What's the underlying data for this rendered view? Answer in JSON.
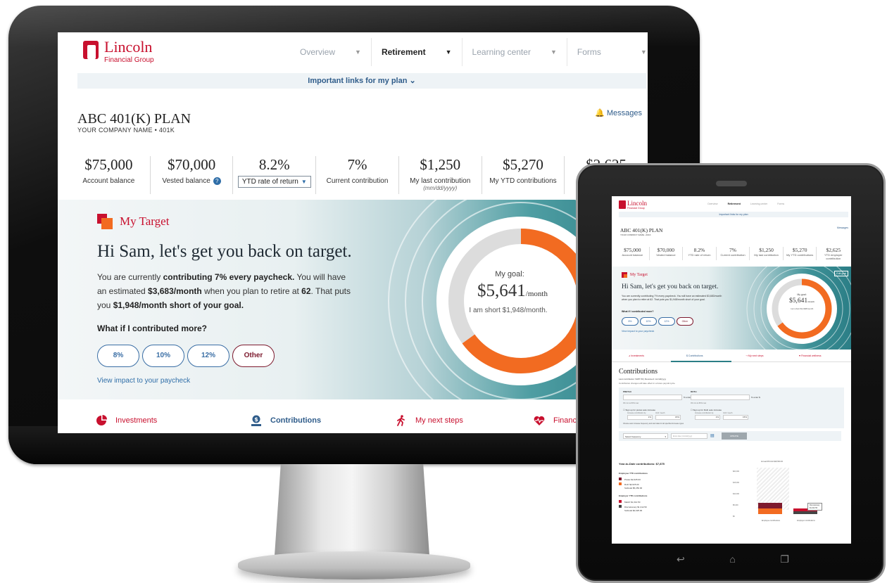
{
  "brand": {
    "name": "Lincoln",
    "sub": "Financial Group",
    "color": "#c8102e",
    "accent": "#f26b21",
    "link": "#2f5c8a"
  },
  "nav": {
    "items": [
      {
        "label": "Overview"
      },
      {
        "label": "Retirement"
      },
      {
        "label": "Learning center"
      },
      {
        "label": "Forms"
      }
    ]
  },
  "links_bar": "Important links for my plan",
  "plan": {
    "title": "ABC 401(K) PLAN",
    "subtitle": "YOUR COMPANY NAME • 401K"
  },
  "messages": "Messages",
  "stats": [
    {
      "value": "$75,000",
      "label": "Account balance"
    },
    {
      "value": "$70,000",
      "label": "Vested balance"
    },
    {
      "value": "8.2%",
      "label": "YTD rate of return"
    },
    {
      "value": "7%",
      "label": "Current contribution"
    },
    {
      "value": "$1,250",
      "label": "My last contribution",
      "sub": "(mm/dd/yyyy)"
    },
    {
      "value": "$5,270",
      "label": "My YTD contributions"
    },
    {
      "value": "$2,625",
      "label": ""
    }
  ],
  "target": {
    "title": "My Target",
    "headline": "Hi Sam, let's get you back on target.",
    "desc_1": "You are currently ",
    "desc_b1": "contributing 7% every paycheck.",
    "desc_2": " You will have an estimated ",
    "desc_b2": "$3,683/month",
    "desc_3": " when you plan to retire at ",
    "desc_b3": "62",
    "desc_4": ". That puts you ",
    "desc_b4": "$1,948/month short of your goal.",
    "whatif": "What if I contributed more?",
    "options": [
      "8%",
      "10%",
      "12%",
      "Other"
    ],
    "view_impact": "View impact to your paycheck",
    "goal_label": "My goal:",
    "goal_value": "$5,641",
    "goal_unit": "/month",
    "goal_short": "I am short $1,948/month.",
    "progress_fraction": 0.65
  },
  "tabs": [
    {
      "label": "Investments"
    },
    {
      "label": "Contributions"
    },
    {
      "label": "My next steps"
    },
    {
      "label": "Financi"
    }
  ],
  "tablet": {
    "brand": "Lincoln",
    "brand_sub": "Financial Group",
    "nav": [
      "Overview",
      "Retirement",
      "Learning center",
      "Forms"
    ],
    "links_bar": "Important links for my plan",
    "plan_title": "ABC 401(K) PLAN",
    "plan_sub": "YOUR COMPANY NAME • 401K",
    "messages": "Messages",
    "stats": [
      {
        "value": "$75,000",
        "label": "Account balance"
      },
      {
        "value": "$70,000",
        "label": "Vested balance"
      },
      {
        "value": "8.2%",
        "label": "YTD rate of return"
      },
      {
        "value": "7%",
        "label": "Current contribution"
      },
      {
        "value": "$1,250",
        "label": "My last contribution"
      },
      {
        "value": "$5,270",
        "label": "My YTD contributions"
      },
      {
        "value": "$2,625",
        "label": "YTD employer contribution"
      }
    ],
    "target_title": "My Target",
    "edit_goal": "Edit goal",
    "headline": "Hi Sam, let's get you back on target.",
    "desc": "You are currently contributing 7% every paycheck. You will have an estimated $3,683/month when you plan to retire at 62. That puts you $1,948/month short of your goal.",
    "whatif": "What if I contributed more?",
    "options": [
      "8%",
      "10%",
      "12%",
      "Other"
    ],
    "view_impact": "View impact to your paycheck",
    "goal_label": "My goal:",
    "goal_value": "$5,641",
    "goal_unit": "/month",
    "goal_short": "I am short $1,948/month",
    "tabs": [
      "Investments",
      "Contributions",
      "My next steps",
      "Financial wellness"
    ],
    "contributions": {
      "title": "Contributions",
      "last": "Last contribution: $187.50",
      "received": "Received: mm/dd/yyyy",
      "note": "Contribution changes will take effect in a future payroll cycle.",
      "pretax_label": "PRETAX",
      "roth_label": "ROTH",
      "pretax_suffix": "% enter $",
      "roth_suffix": "% enter $",
      "pretax_hint": "0% min to 80% max",
      "roth_hint": "0% min to 80% max",
      "pretax_auto": "Sign up for pretax auto increase",
      "roth_auto": "Sign up for Roth auto increase",
      "pretax_inc_label": "Increase contribution by",
      "pretax_until_label": "Until I reach",
      "pretax_inc": "1%",
      "pretax_until": "15%",
      "roth_inc_label": "Increase contribution by",
      "roth_until_label": "Until I reach",
      "roth_inc": "1%",
      "roth_until": "15%",
      "frequency_note": "Choose auto increase frequency and start date for all specified increase types",
      "frequency_placeholder": "Select frequency",
      "date_placeholder": "Enter date (mm/dd/yyyy)",
      "update": "UPDATE",
      "ytd_title": "Year-to-Date contributions: $7,875",
      "employee_title": "Employee YTD contributions",
      "employee_rows": [
        {
          "name": "Pretax",
          "value": "$2,625.00"
        },
        {
          "name": "Roth",
          "value": "$2,625.00"
        },
        {
          "name": "Subtotal",
          "value": "$5,250.00"
        }
      ],
      "employer_title": "Employer YTD contributions",
      "employer_rows": [
        {
          "name": "Match",
          "value": "$1,312.50"
        },
        {
          "name": "Discretionary",
          "value": "$1,312.50"
        },
        {
          "name": "Subtotal",
          "value": "$2,625.00"
        }
      ],
      "chart_caption": "Annual IRS limit $18,500.00",
      "y_ticks": [
        "$20,000",
        "$15,000",
        "$10,000",
        "$5,000",
        "$0"
      ],
      "bar_labels": [
        "Employee contributions",
        "Employer contributions"
      ],
      "tooltip_title": "Discretionary",
      "tooltip_value": "$1,312.50"
    }
  }
}
